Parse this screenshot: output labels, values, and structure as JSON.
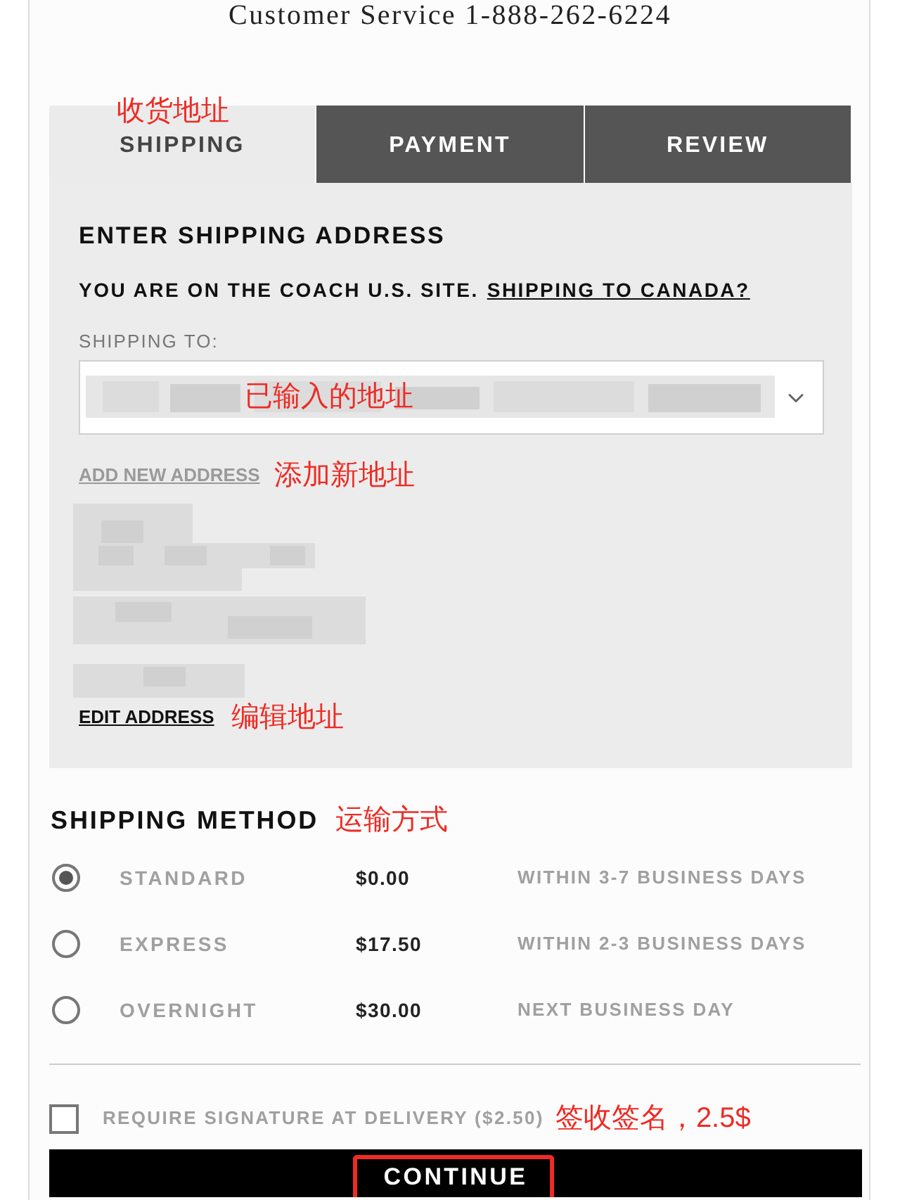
{
  "header": {
    "customer_service": "Customer Service 1-888-262-6224"
  },
  "tabs": [
    {
      "label": "SHIPPING",
      "selected": true,
      "annotation": "收货地址"
    },
    {
      "label": "PAYMENT",
      "selected": false
    },
    {
      "label": "REVIEW",
      "selected": false
    }
  ],
  "shipping_address": {
    "title": "ENTER SHIPPING ADDRESS",
    "site_notice": "YOU ARE ON THE COACH U.S. SITE.",
    "canada_link": "SHIPPING TO CANADA?",
    "shipping_to_label": "SHIPPING TO:",
    "address_select": {
      "annotation": "已输入的地址"
    },
    "add_new_address": {
      "label": "ADD NEW ADDRESS",
      "annotation": "添加新地址"
    },
    "edit_address": {
      "label": "EDIT ADDRESS",
      "annotation": "编辑地址"
    }
  },
  "shipping_method": {
    "title": "SHIPPING METHOD",
    "annotation": "运输方式",
    "options": [
      {
        "name": "STANDARD",
        "price": "$0.00",
        "delivery": "WITHIN 3-7 BUSINESS DAYS",
        "selected": true
      },
      {
        "name": "EXPRESS",
        "price": "$17.50",
        "delivery": "WITHIN 2-3 BUSINESS DAYS",
        "selected": false
      },
      {
        "name": "OVERNIGHT",
        "price": "$30.00",
        "delivery": "NEXT BUSINESS DAY",
        "selected": false
      }
    ]
  },
  "signature": {
    "label": "REQUIRE SIGNATURE AT DELIVERY ($2.50)",
    "checked": false,
    "annotation": "签收签名，2.5$"
  },
  "continue_button": {
    "label": "CONTINUE",
    "highlighted": true
  }
}
